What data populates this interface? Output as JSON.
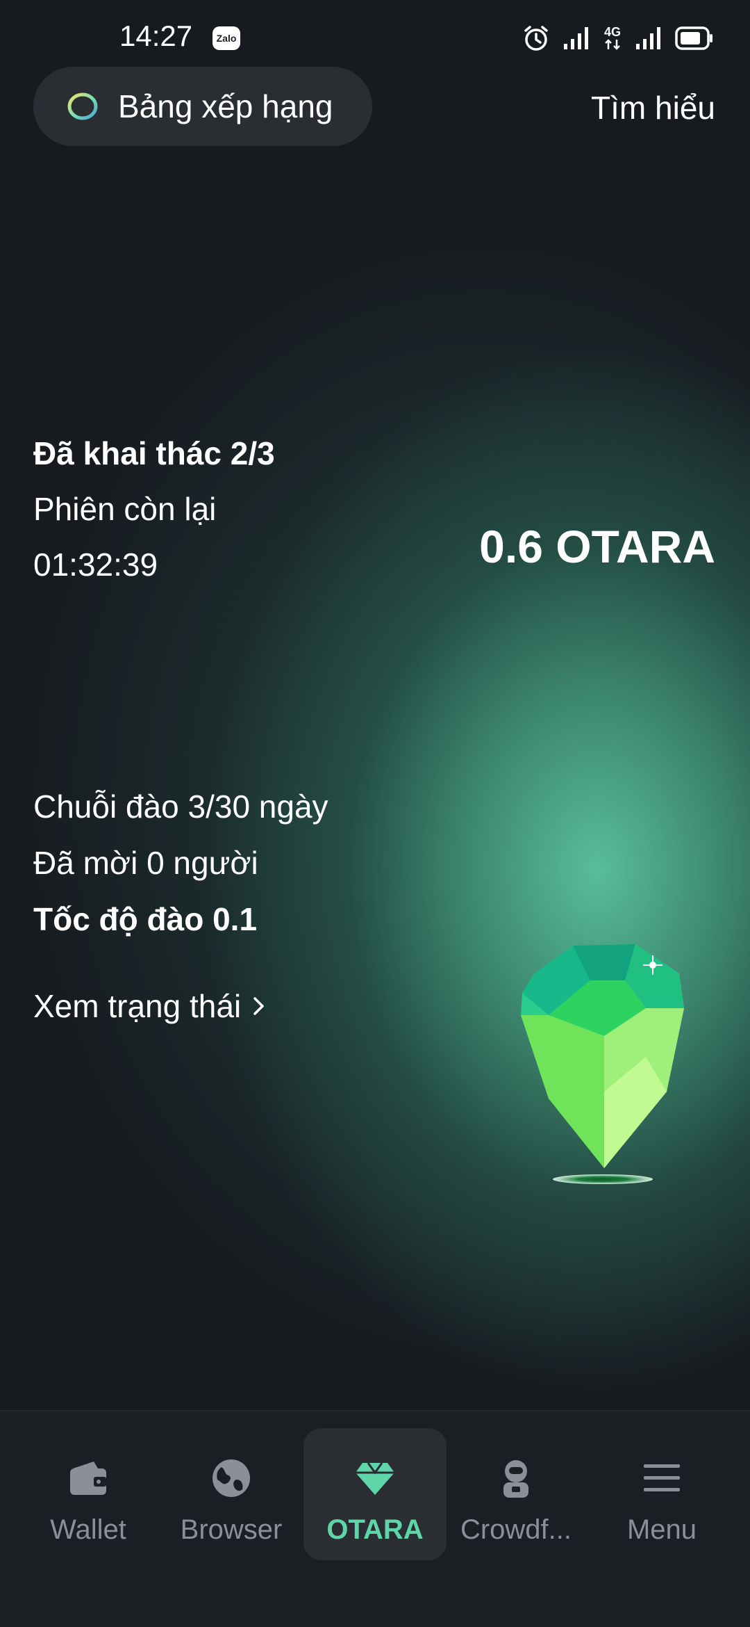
{
  "status_bar": {
    "time": "14:27",
    "app_badge": "Zalo",
    "network": "4G",
    "icons": [
      "alarm-icon",
      "signal-icon",
      "network-4g-icon",
      "signal-icon",
      "battery-icon"
    ]
  },
  "header": {
    "leaderboard_label": "Bảng xếp hạng",
    "learn_more_label": "Tìm hiểu"
  },
  "mining": {
    "mined_sessions": "Đã khai thác 2/3",
    "remaining_session_label": "Phiên còn lại",
    "remaining_time": "01:32:39",
    "balance": "0.6 OTARA"
  },
  "stats": {
    "streak": "Chuỗi đào 3/30 ngày",
    "invited": "Đã mời 0 người",
    "mining_speed": "Tốc độ đào 0.1",
    "view_status_label": "Xem trạng thái"
  },
  "nav": {
    "items": [
      {
        "label": "Wallet",
        "icon": "wallet-icon",
        "active": false
      },
      {
        "label": "Browser",
        "icon": "globe-icon",
        "active": false
      },
      {
        "label": "OTARA",
        "icon": "diamond-icon",
        "active": true
      },
      {
        "label": "Crowdf...",
        "icon": "astronaut-icon",
        "active": false
      },
      {
        "label": "Menu",
        "icon": "menu-icon",
        "active": false
      }
    ]
  },
  "colors": {
    "background": "#171b20",
    "accent": "#5fd6a9",
    "nav_background": "#1b1e23",
    "pill_background": "#2a2e33"
  }
}
